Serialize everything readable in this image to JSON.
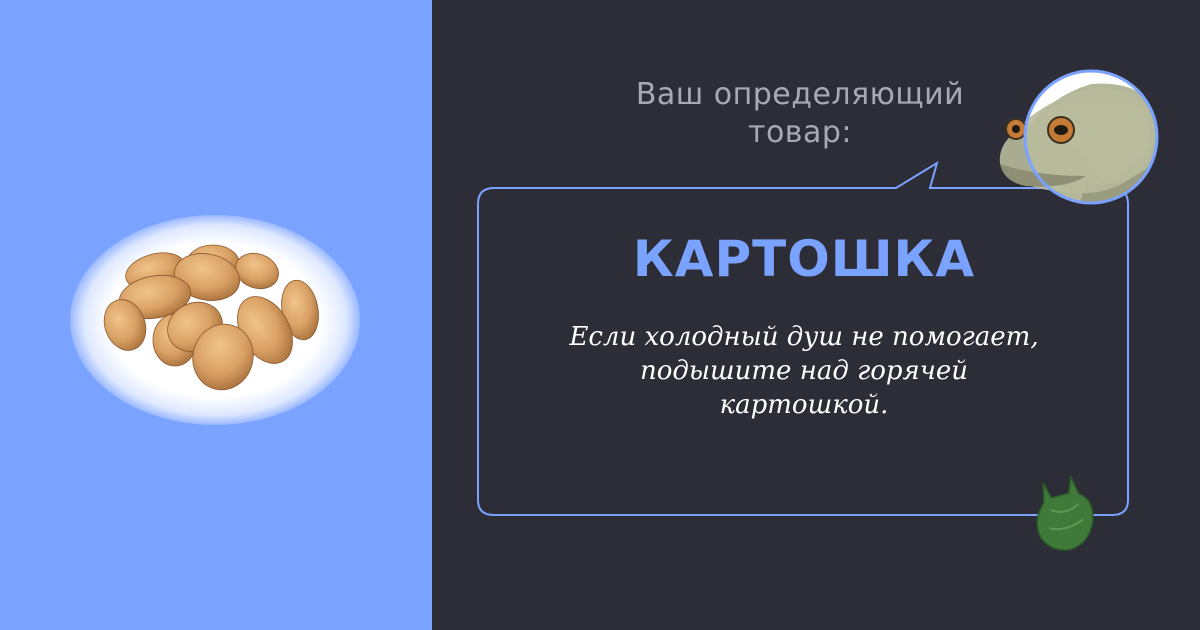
{
  "colors": {
    "left_background": "#7aa2ff",
    "right_background": "#2d2d37",
    "accent": "#7aa2ff",
    "intro_text": "#a9a9b3",
    "tip_text": "#ffffff"
  },
  "intro_text": "Ваш определяющий\nтовар:",
  "product_name": "КАРТОШКА",
  "tip_text": "Если холодный душ не помогает,\nподышите над горячей\nкартошкой.",
  "images": {
    "potatoes": "potatoes-illustration",
    "avatar": "toad-avatar",
    "bag": "green-plastic-bag-icon"
  }
}
